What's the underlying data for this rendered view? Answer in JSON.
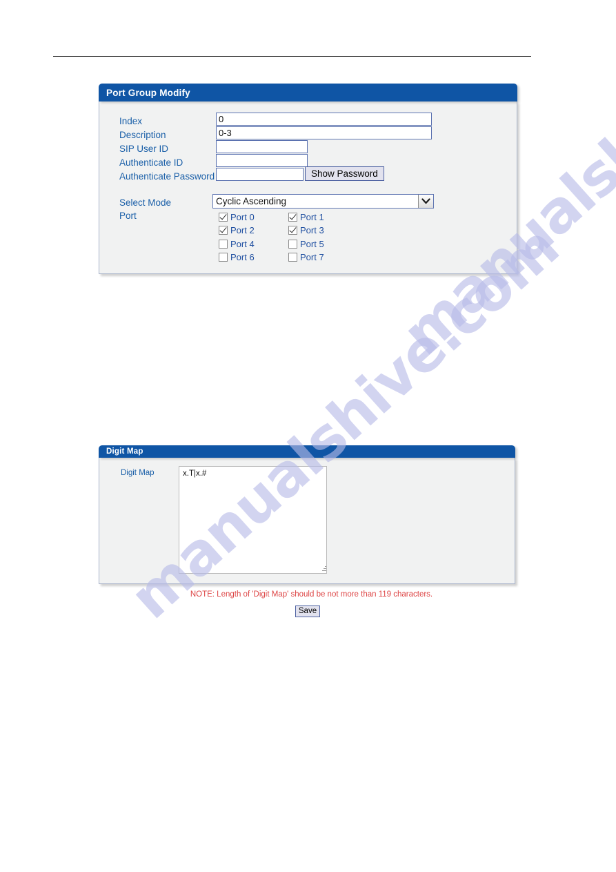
{
  "watermark": {
    "text": "manualshive.com",
    "color": "#b7bbe8"
  },
  "port_group_panel": {
    "title": "Port Group Modify",
    "fields": {
      "index": {
        "label": "Index",
        "value": "0"
      },
      "description": {
        "label": "Description",
        "value": "0-3"
      },
      "sip_user_id": {
        "label": "SIP User ID",
        "value": ""
      },
      "authenticate_id": {
        "label": "Authenticate ID",
        "value": ""
      },
      "authenticate_password": {
        "label": "Authenticate Password",
        "value": ""
      }
    },
    "show_password_button": "Show Password",
    "select_mode": {
      "label": "Select Mode",
      "selected": "Cyclic Ascending"
    },
    "port": {
      "label": "Port",
      "items": [
        {
          "label": "Port 0",
          "checked": true
        },
        {
          "label": "Port 1",
          "checked": true
        },
        {
          "label": "Port 2",
          "checked": true
        },
        {
          "label": "Port 3",
          "checked": true
        },
        {
          "label": "Port 4",
          "checked": false
        },
        {
          "label": "Port 5",
          "checked": false
        },
        {
          "label": "Port 6",
          "checked": false
        },
        {
          "label": "Port 7",
          "checked": false
        }
      ]
    }
  },
  "digit_map_panel": {
    "title": "Digit Map",
    "field_label": "Digit Map",
    "value": "x.T|x.#",
    "note": "NOTE: Length of 'Digit Map' should be not more than 119 characters."
  },
  "save_button": "Save",
  "colors": {
    "header_blue": "#0f55a5",
    "label_blue": "#1a5fa8",
    "port_label_blue": "#1f4fa0",
    "note_red": "#dd4444",
    "panel_bg": "#f1f2f2"
  }
}
